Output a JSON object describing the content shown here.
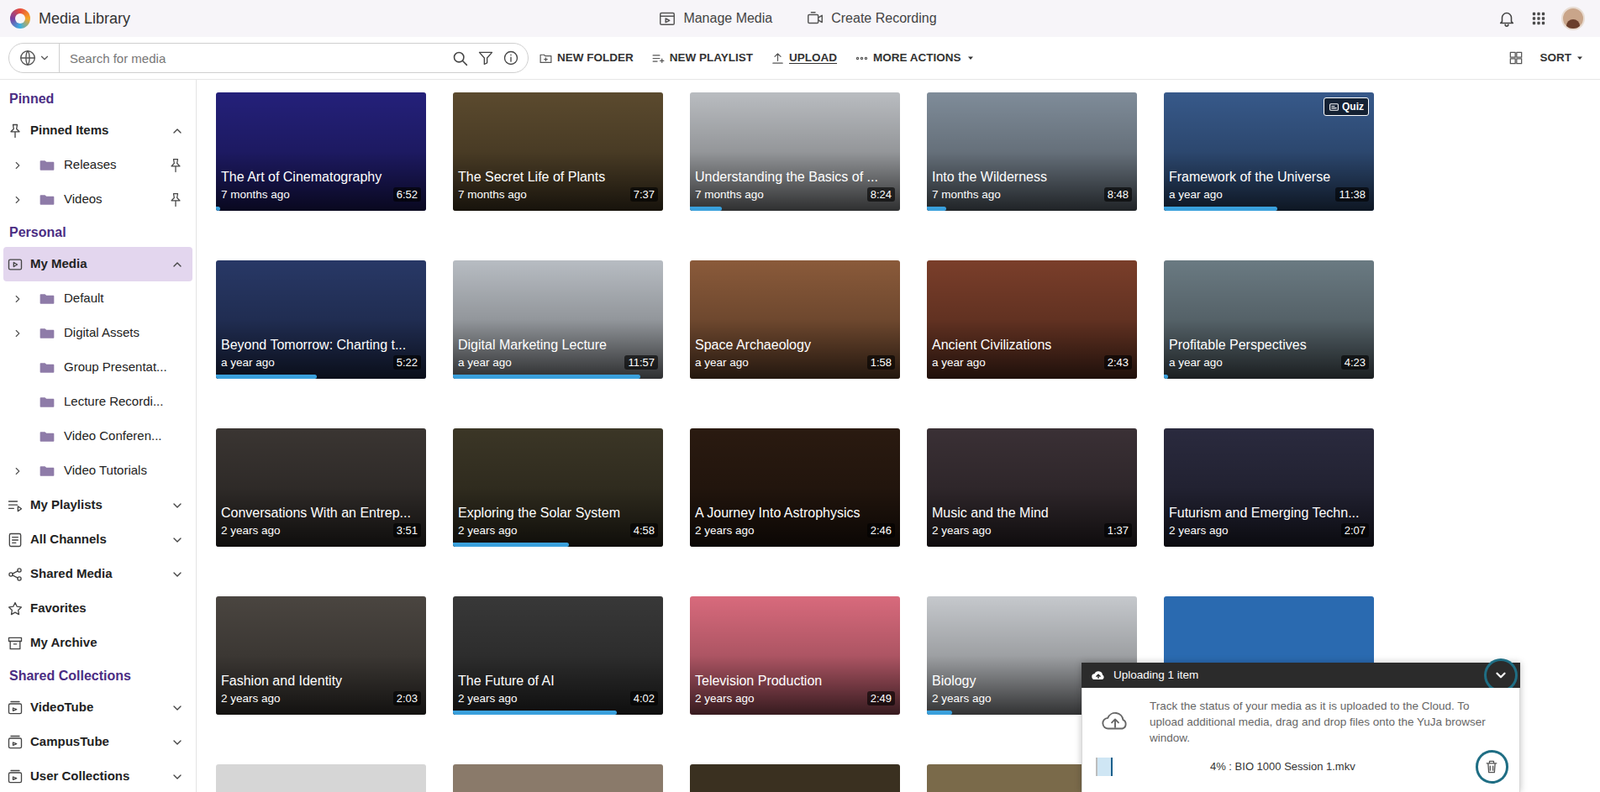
{
  "topbar": {
    "title": "Media Library",
    "nav": [
      "Manage Media",
      "Create Recording"
    ]
  },
  "toolbar": {
    "search_placeholder": "Search for media",
    "actions": [
      {
        "label": "NEW FOLDER",
        "hovered": false,
        "menu": false
      },
      {
        "label": "NEW PLAYLIST",
        "hovered": false,
        "menu": false
      },
      {
        "label": "UPLOAD",
        "hovered": true,
        "menu": false
      },
      {
        "label": "MORE ACTIONS",
        "hovered": false,
        "menu": true
      }
    ],
    "sort": "SORT"
  },
  "sidebar": {
    "sections": [
      {
        "heading": "Pinned",
        "items": [
          {
            "label": "Pinned Items",
            "kind": "group",
            "expanded": true,
            "selected": false
          },
          {
            "label": "Releases",
            "kind": "folder",
            "caret": true,
            "pinned": true,
            "selected": false
          },
          {
            "label": "Videos",
            "kind": "folder",
            "caret": true,
            "pinned": true,
            "selected": false
          }
        ]
      },
      {
        "heading": "Personal",
        "items": [
          {
            "label": "My Media",
            "kind": "group",
            "expanded": true,
            "selected": true
          },
          {
            "label": "Default",
            "kind": "folder",
            "caret": true,
            "pinned": false,
            "selected": false
          },
          {
            "label": "Digital Assets",
            "kind": "folder",
            "caret": true,
            "pinned": false,
            "selected": false
          },
          {
            "label": "Group Presentat...",
            "kind": "folder",
            "caret": false,
            "pinned": false,
            "selected": false
          },
          {
            "label": "Lecture Recordi...",
            "kind": "folder",
            "caret": false,
            "pinned": false,
            "selected": false
          },
          {
            "label": "Video Conferen...",
            "kind": "folder",
            "caret": false,
            "pinned": false,
            "selected": false
          },
          {
            "label": "Video Tutorials",
            "kind": "folder",
            "caret": true,
            "pinned": false,
            "selected": false
          },
          {
            "label": "My Playlists",
            "kind": "group",
            "expanded": false,
            "selected": false
          },
          {
            "label": "All Channels",
            "kind": "group",
            "expanded": false,
            "selected": false
          },
          {
            "label": "Shared Media",
            "kind": "group",
            "expanded": false,
            "selected": false
          },
          {
            "label": "Favorites",
            "kind": "link",
            "selected": false
          },
          {
            "label": "My Archive",
            "kind": "link",
            "selected": false
          }
        ]
      },
      {
        "heading": "Shared Collections",
        "items": [
          {
            "label": "VideoTube",
            "kind": "group",
            "expanded": false,
            "selected": false
          },
          {
            "label": "CampusTube",
            "kind": "group",
            "expanded": false,
            "selected": false
          },
          {
            "label": "User Collections",
            "kind": "group",
            "expanded": false,
            "selected": false
          }
        ]
      }
    ]
  },
  "cards": [
    {
      "kind": "full",
      "title": "The Art of Cinematography",
      "ago": "7 months ago",
      "duration": "6:52",
      "level": 0.02
    },
    {
      "kind": "full",
      "title": "The Secret Life of Plants",
      "ago": "7 months ago",
      "duration": "7:37",
      "level": 0
    },
    {
      "kind": "full",
      "title": "Understanding the Basics of ...",
      "ago": "7 months ago",
      "duration": "8:24",
      "level": 0.15
    },
    {
      "kind": "full",
      "title": "Into the Wilderness",
      "ago": "7 months ago",
      "duration": "8:48",
      "level": 0.09
    },
    {
      "kind": "full",
      "title": "Framework of the Universe",
      "ago": "a year ago",
      "duration": "11:38",
      "level": 0.54,
      "badge": "Quiz"
    },
    {
      "kind": "full",
      "title": "Beyond Tomorrow: Charting t...",
      "ago": "a year ago",
      "duration": "5:22",
      "level": 0.48
    },
    {
      "kind": "full",
      "title": "Digital Marketing Lecture",
      "ago": "a year ago",
      "duration": "11:57",
      "level": 0.89
    },
    {
      "kind": "full",
      "title": "Space Archaeology",
      "ago": "a year ago",
      "duration": "1:58",
      "level": 0
    },
    {
      "kind": "full",
      "title": "Ancient Civilizations",
      "ago": "a year ago",
      "duration": "2:43",
      "level": 0
    },
    {
      "kind": "full",
      "title": "Profitable Perspectives",
      "ago": "a year ago",
      "duration": "4:23",
      "level": 0.02
    },
    {
      "kind": "full",
      "title": "Conversations With an Entrep...",
      "ago": "2 years ago",
      "duration": "3:51",
      "level": 0
    },
    {
      "kind": "full",
      "title": "Exploring the Solar System",
      "ago": "2 years ago",
      "duration": "4:58",
      "level": 0.55
    },
    {
      "kind": "full",
      "title": "A Journey Into Astrophysics",
      "ago": "2 years ago",
      "duration": "2:46",
      "level": 0
    },
    {
      "kind": "full",
      "title": "Music and the Mind",
      "ago": "2 years ago",
      "duration": "1:37",
      "level": 0
    },
    {
      "kind": "full",
      "title": "Futurism and Emerging Techn...",
      "ago": "2 years ago",
      "duration": "2:07",
      "level": 0
    },
    {
      "kind": "full",
      "title": "Fashion and Identity",
      "ago": "2 years ago",
      "duration": "2:03",
      "level": 0
    },
    {
      "kind": "full",
      "title": "The Future of AI",
      "ago": "2 years ago",
      "duration": "4:02",
      "level": 0.78
    },
    {
      "kind": "full",
      "title": "Television Production",
      "ago": "2 years ago",
      "duration": "2:49",
      "level": 0
    },
    {
      "kind": "full",
      "title": "Biology",
      "ago": "2 years ago",
      "duration": "",
      "level": 0.12
    },
    {
      "kind": "cropped"
    },
    {
      "kind": "cropped"
    },
    {
      "kind": "cropped"
    },
    {
      "kind": "cropped"
    },
    {
      "kind": "cropped"
    },
    {
      "kind": "cropped"
    }
  ],
  "upload": {
    "header": "Uploading 1 item",
    "message": "Track the status of your media as it is uploaded to the Cloud. To upload additional media, drag and drop files onto the YuJa browser window.",
    "file": {
      "reading": "4% : BIO 1000 Session 1.mkv",
      "level": 0.04
    },
    "collapse_focused": true,
    "delete_focused": true
  }
}
